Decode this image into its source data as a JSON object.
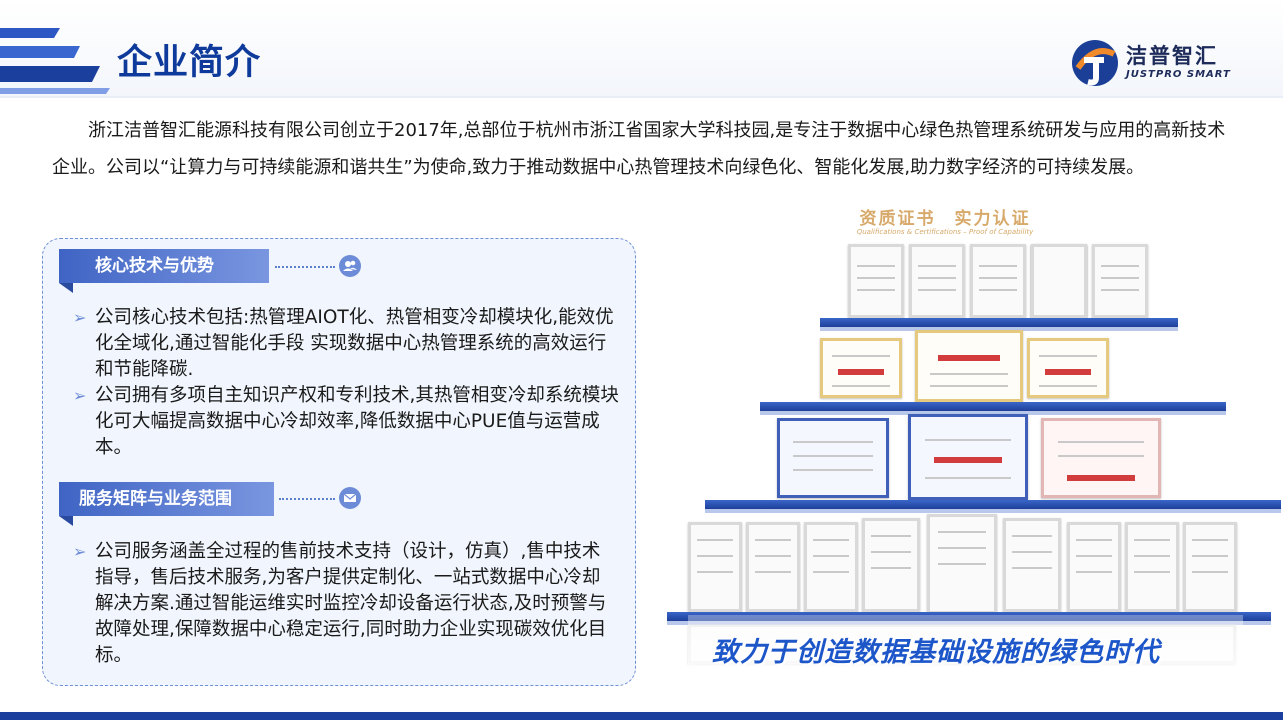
{
  "header": {
    "title": "企业简介",
    "logo_cn": "洁普智汇",
    "logo_en": "JUSTPRO SMART"
  },
  "intro": "浙江洁普智汇能源科技有限公司创立于2017年,总部位于杭州市浙江省国家大学科技园,是专注于数据中心绿色热管理系统研发与应用的高新技术企业。公司以“让算力与可持续能源和谐共生”为使命,致力于推动数据中心热管理技术向绿色化、智能化发展,助力数字经济的可持续发展。",
  "sections": [
    {
      "title": "核心技术与优势",
      "icon": "users-icon",
      "bullets": [
        "公司核心技术包括:热管理AIOT化、热管相变冷却模块化,能效优化全域化,通过智能化手段 实现数据中心热管理系统的高效运行和节能降碳.",
        "公司拥有多项自主知识产权和专利技术,其热管相变冷却系统模块化可大幅提高数据中心冷却效率,降低数据中心PUE值与运营成本。"
      ]
    },
    {
      "title": "服务矩阵与业务范围",
      "icon": "mail-icon",
      "bullets": [
        "公司服务涵盖全过程的售前技术支持（设计，仿真）,售中技术指导，售后技术服务,为客户提供定制化、一站式数据中心冷却解决方案.通过智能运维实时监控冷却设备运行状态,及时预警与故障处理,保障数据中心稳定运行,同时助力企业实现碳效优化目标。"
      ]
    }
  ],
  "certificates": {
    "heading": "资质证书　实力认证",
    "subheading": "Qualifications & Certifications – Proof of Capability",
    "slogan": "致力于创造数据基础设施的绿色时代"
  },
  "colors": {
    "brand_blue": "#0e3a9b",
    "accent_blue": "#1c56c9",
    "gold": "#d7a96a"
  }
}
